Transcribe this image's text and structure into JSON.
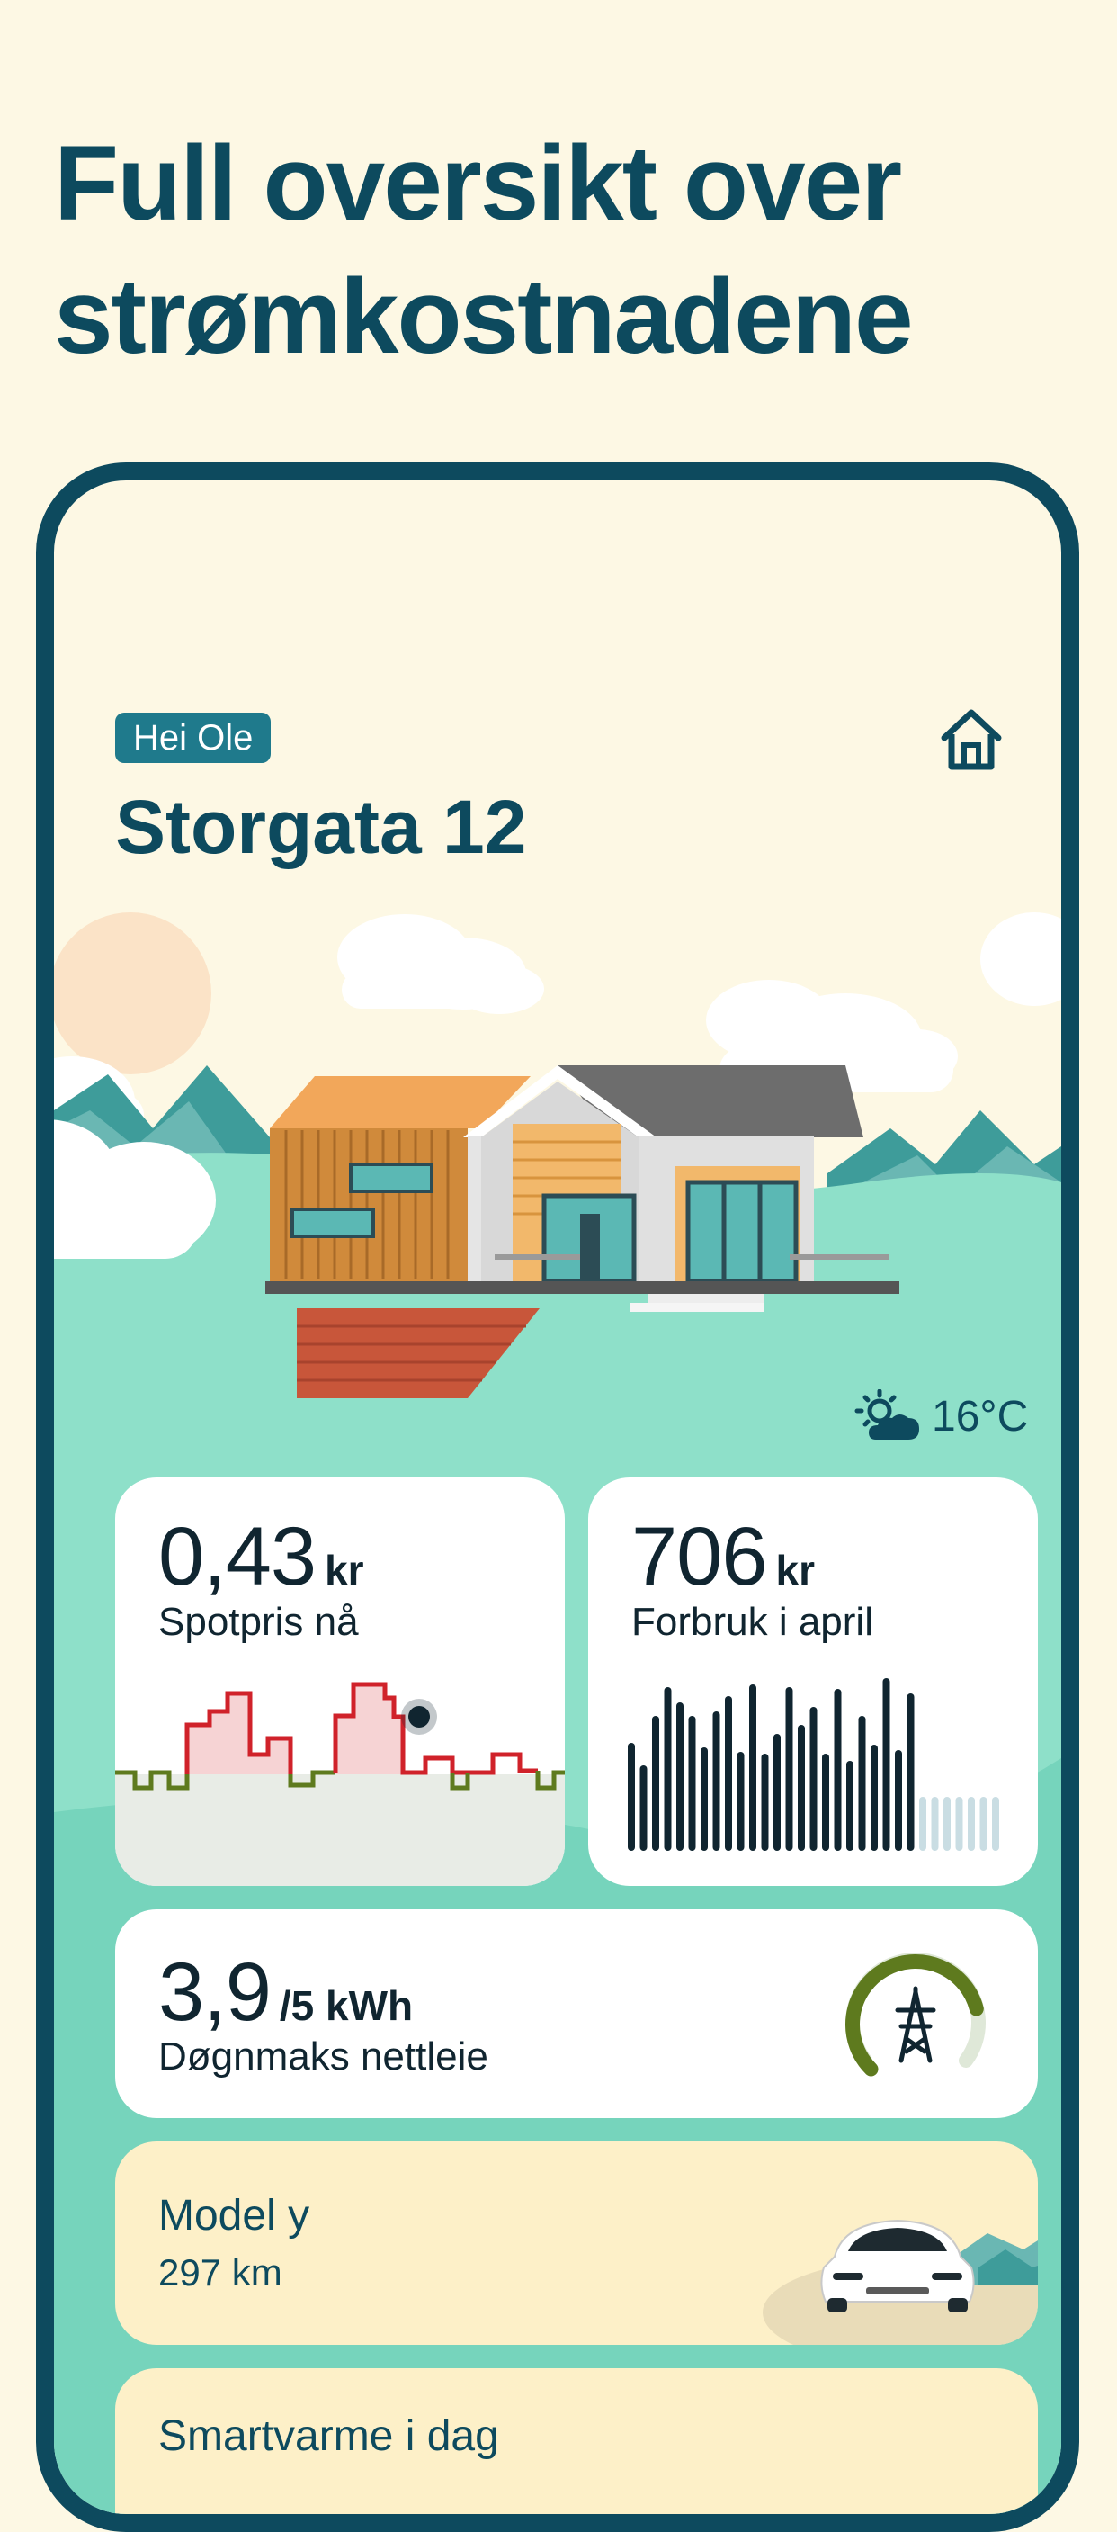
{
  "headline": {
    "line1": "Full oversikt over",
    "line2": "strømkostnadene"
  },
  "app": {
    "greeting": "Hei Ole",
    "address": "Storgata 12",
    "weather": {
      "icon": "partly-cloudy-sun-icon",
      "temperature": "16°C"
    }
  },
  "cards": {
    "spot_price": {
      "value": "0,43",
      "unit": "kr",
      "label": "Spotpris nå"
    },
    "consumption": {
      "value": "706",
      "unit": "kr",
      "label": "Forbruk i april"
    },
    "grid_max": {
      "value": "3,9",
      "unit": "/5 kWh",
      "label": "Døgnmaks nettleie",
      "fraction": 0.78
    },
    "ev": {
      "name": "Model y",
      "range": "297 km"
    },
    "smart_heating": {
      "title": "Smartvarme i dag"
    }
  },
  "colors": {
    "brand_dark": "#0d4a5e",
    "badge": "#1f7a8c",
    "background": "#fdf8e4",
    "hill": "#8ee0c9",
    "price_high": "#d0222a",
    "price_low": "#5e7a1e",
    "gauge": "#5e7a1e"
  }
}
